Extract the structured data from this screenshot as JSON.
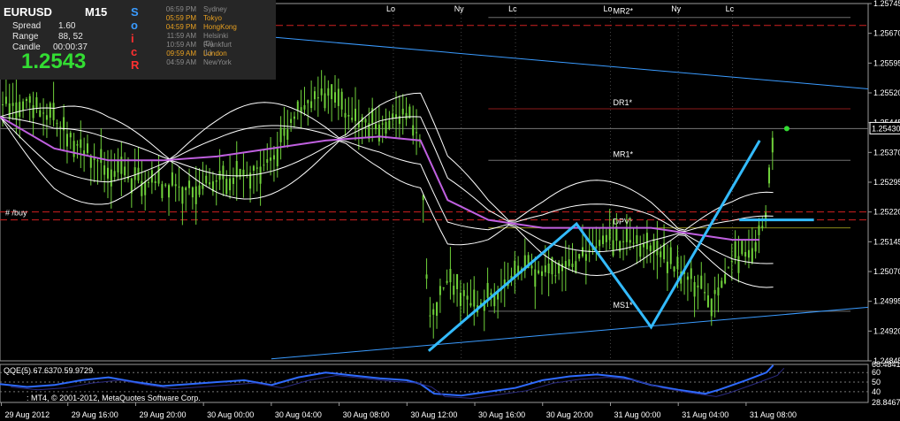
{
  "header": {
    "symbol": "EURUSD",
    "timeframe": "M15",
    "spread_label": "Spread",
    "spread_value": "1.60",
    "range_label": "Range",
    "range_value": "88, 52",
    "candle_label": "Candle",
    "candle_value": "00:00:37",
    "bid": "1.2543",
    "vertical_letters": [
      {
        "ch": "S",
        "color": "#3a9bff"
      },
      {
        "ch": "o",
        "color": "#3a9bff"
      },
      {
        "ch": "i",
        "color": "#ff3030"
      },
      {
        "ch": "c",
        "color": "#ff3030"
      },
      {
        "ch": "R",
        "color": "#ff3030"
      }
    ],
    "sessions": [
      {
        "time": "06:59 PM",
        "name": "Sydney",
        "color": "#8a8a8a"
      },
      {
        "time": "05:59 PM",
        "name": "Tokyo",
        "color": "#e8a020"
      },
      {
        "time": "04:59 PM",
        "name": "HongKong",
        "color": "#e8a020"
      },
      {
        "time": "11:59 AM",
        "name": "Helsinki (D)",
        "color": "#8a8a8a"
      },
      {
        "time": "10:59 AM",
        "name": "Frankfurt (L)",
        "color": "#8a8a8a"
      },
      {
        "time": "09:59 AM",
        "name": "London",
        "color": "#e8a020"
      },
      {
        "time": "04:59 AM",
        "name": "NewYork",
        "color": "#8a8a8a"
      }
    ]
  },
  "buy_label": "# /buy",
  "session_markers": [
    {
      "label": "Lo",
      "slot": 29
    },
    {
      "label": "Ny",
      "slot": 34
    },
    {
      "label": "Lc",
      "slot": 38
    },
    {
      "label": "Lo",
      "slot": 45
    },
    {
      "label": "Ny",
      "slot": 50
    },
    {
      "label": "Lc",
      "slot": 54
    }
  ],
  "oscillator": {
    "label": "QQE(5) 67.6370 59.9729",
    "yticks": [
      "68.4841",
      "60",
      "50",
      "40",
      "28.8467"
    ]
  },
  "footer": {
    "copyright": ": MT4, © 2001-2012, MetaQuotes Software Corp."
  },
  "chart_data": {
    "type": "candlestick",
    "instrument": "EURUSD",
    "timeframe": "M15",
    "current_price": 1.2543,
    "current_price_label": "1.25430",
    "ylim": [
      1.24845,
      1.25745
    ],
    "yticks": [
      "1.25745",
      "1.25670",
      "1.25595",
      "1.25520",
      "1.25445",
      "1.25370",
      "1.25295",
      "1.25220",
      "1.25145",
      "1.25070",
      "1.24995",
      "1.24920",
      "1.24845"
    ],
    "xticks": [
      "29 Aug 2012",
      "29 Aug 16:00",
      "29 Aug 20:00",
      "30 Aug 00:00",
      "30 Aug 04:00",
      "30 Aug 08:00",
      "30 Aug 12:00",
      "30 Aug 16:00",
      "30 Aug 20:00",
      "31 Aug 00:00",
      "31 Aug 04:00",
      "31 Aug 08:00"
    ],
    "pivot_levels": [
      {
        "name": "MR2*",
        "value": 1.2571,
        "color": "#6e6e6e"
      },
      {
        "name": "DR1*",
        "value": 1.2548,
        "color": "#8b1a1a"
      },
      {
        "name": "MR1*",
        "value": 1.2535,
        "color": "#6e6e6e"
      },
      {
        "name": "DPV*",
        "value": 1.2518,
        "color": "#8a8a1a"
      },
      {
        "name": "MS1*",
        "value": 1.2497,
        "color": "#6e6e6e"
      }
    ],
    "dashed_levels": [
      1.2569,
      1.2522,
      1.252
    ],
    "close_path": [
      [
        0,
        1.2549
      ],
      [
        2,
        1.255
      ],
      [
        4,
        1.2545
      ],
      [
        6,
        1.2538
      ],
      [
        8,
        1.2533
      ],
      [
        10,
        1.253
      ],
      [
        12,
        1.2529
      ],
      [
        14,
        1.2528
      ],
      [
        16,
        1.253
      ],
      [
        18,
        1.2531
      ],
      [
        20,
        1.2535
      ],
      [
        22,
        1.2548
      ],
      [
        24,
        1.2552
      ],
      [
        26,
        1.2545
      ],
      [
        28,
        1.2544
      ],
      [
        30,
        1.2547
      ],
      [
        31,
        1.254
      ],
      [
        31.6,
        1.2495
      ],
      [
        33,
        1.2505
      ],
      [
        35,
        1.2498
      ],
      [
        37,
        1.2503
      ],
      [
        39,
        1.2508
      ],
      [
        41,
        1.2506
      ],
      [
        43,
        1.2511
      ],
      [
        45,
        1.2515
      ],
      [
        47,
        1.2514
      ],
      [
        49,
        1.251
      ],
      [
        51,
        1.2505
      ],
      [
        52.5,
        1.25
      ],
      [
        54,
        1.251
      ],
      [
        55.5,
        1.2513
      ],
      [
        56.5,
        1.252
      ],
      [
        57,
        1.2543
      ]
    ],
    "ma_path": [
      [
        0,
        1.2546
      ],
      [
        4,
        1.2538
      ],
      [
        8,
        1.2535
      ],
      [
        12,
        1.2535
      ],
      [
        16,
        1.2536
      ],
      [
        20,
        1.2538
      ],
      [
        24,
        1.254
      ],
      [
        28,
        1.2541
      ],
      [
        31,
        1.254
      ],
      [
        33,
        1.2525
      ],
      [
        36,
        1.252
      ],
      [
        40,
        1.2518
      ],
      [
        44,
        1.2518
      ],
      [
        48,
        1.2518
      ],
      [
        52,
        1.2516
      ],
      [
        54,
        1.2515
      ],
      [
        56,
        1.2515
      ]
    ],
    "pattern_lines": [
      {
        "points": [
          [
            31.6,
            1.2487
          ],
          [
            42.5,
            1.2519
          ],
          [
            48,
            1.2493
          ],
          [
            56,
            1.254
          ]
        ],
        "color": "#33bbff"
      },
      {
        "points": [
          [
            54.5,
            1.252
          ],
          [
            60,
            1.252
          ]
        ],
        "color": "#33bbff"
      }
    ],
    "trendlines": [
      {
        "points": [
          [
            0,
            1.2572
          ],
          [
            64,
            1.2553
          ]
        ],
        "color": "#3a9bff"
      },
      {
        "points": [
          [
            20,
            1.2485
          ],
          [
            64,
            1.2498
          ]
        ],
        "color": "#3a9bff"
      }
    ],
    "oscillator": {
      "name": "QQE(5)",
      "ylim": [
        28.8467,
        68.4841
      ],
      "values": [
        [
          0,
          48
        ],
        [
          2,
          45
        ],
        [
          4,
          47
        ],
        [
          6,
          52
        ],
        [
          8,
          55
        ],
        [
          10,
          50
        ],
        [
          12,
          46
        ],
        [
          14,
          48
        ],
        [
          16,
          50
        ],
        [
          18,
          52
        ],
        [
          20,
          47
        ],
        [
          22,
          55
        ],
        [
          24,
          60
        ],
        [
          26,
          57
        ],
        [
          28,
          54
        ],
        [
          30,
          52
        ],
        [
          31,
          48
        ],
        [
          32,
          38
        ],
        [
          34,
          36
        ],
        [
          36,
          40
        ],
        [
          38,
          44
        ],
        [
          40,
          52
        ],
        [
          42,
          56
        ],
        [
          44,
          58
        ],
        [
          46,
          55
        ],
        [
          48,
          47
        ],
        [
          50,
          42
        ],
        [
          52,
          38
        ],
        [
          53,
          42
        ],
        [
          55,
          52
        ],
        [
          56.5,
          60
        ],
        [
          57,
          67.6
        ]
      ]
    }
  }
}
